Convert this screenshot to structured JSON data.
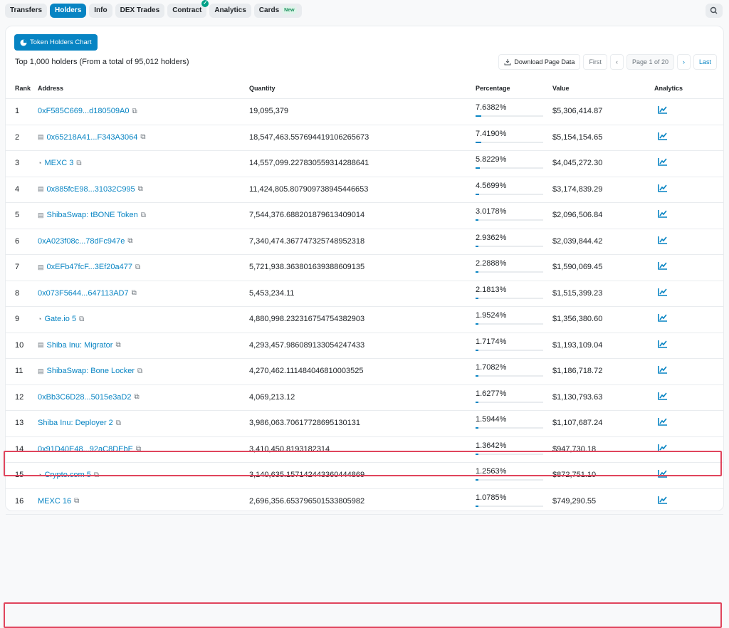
{
  "tabs": [
    {
      "label": "Transfers",
      "active": false
    },
    {
      "label": "Holders",
      "active": true
    },
    {
      "label": "Info",
      "active": false
    },
    {
      "label": "DEX Trades",
      "active": false
    },
    {
      "label": "Contract",
      "active": false,
      "verified": true
    },
    {
      "label": "Analytics",
      "active": false
    },
    {
      "label": "Cards",
      "active": false,
      "badge": "New"
    }
  ],
  "chart_button": "Token Holders Chart",
  "summary": "Top 1,000 holders (From a total of 95,012 holders)",
  "pager": {
    "download": "Download Page Data",
    "first": "First",
    "page_info": "Page 1 of 20",
    "last": "Last"
  },
  "columns": {
    "rank": "Rank",
    "address": "Address",
    "quantity": "Quantity",
    "percentage": "Percentage",
    "value": "Value",
    "analytics": "Analytics"
  },
  "holders": [
    {
      "rank": "1",
      "address": "0xF585C669...d180509A0",
      "icon": "",
      "quantity": "19,095,379",
      "percentage": "7.6382%",
      "pct": 7.6382,
      "value": "$5,306,414.87",
      "highlight": false
    },
    {
      "rank": "2",
      "address": "0x65218A41...F343A3064",
      "icon": "contract-icon",
      "quantity": "18,547,463.557694419106265673",
      "percentage": "7.4190%",
      "pct": 7.419,
      "value": "$5,154,154.65",
      "highlight": false
    },
    {
      "rank": "3",
      "address": "MEXC 3",
      "icon": "exchange-icon",
      "quantity": "14,557,099.227830559314288641",
      "percentage": "5.8229%",
      "pct": 5.8229,
      "value": "$4,045,272.30",
      "highlight": false
    },
    {
      "rank": "4",
      "address": "0x885fcE98...31032C995",
      "icon": "contract-icon",
      "quantity": "11,424,805.807909738945446653",
      "percentage": "4.5699%",
      "pct": 4.5699,
      "value": "$3,174,839.29",
      "highlight": false
    },
    {
      "rank": "5",
      "address": "ShibaSwap: tBONE Token",
      "icon": "contract-icon",
      "quantity": "7,544,376.688201879613409014",
      "percentage": "3.0178%",
      "pct": 3.0178,
      "value": "$2,096,506.84",
      "highlight": false
    },
    {
      "rank": "6",
      "address": "0xA023f08c...78dFc947e",
      "icon": "",
      "quantity": "7,340,474.367747325748952318",
      "percentage": "2.9362%",
      "pct": 2.9362,
      "value": "$2,039,844.42",
      "highlight": false
    },
    {
      "rank": "7",
      "address": "0xEFb47fcF...3Ef20a477",
      "icon": "contract-icon",
      "quantity": "5,721,938.363801639388609135",
      "percentage": "2.2888%",
      "pct": 2.2888,
      "value": "$1,590,069.45",
      "highlight": false
    },
    {
      "rank": "8",
      "address": "0x073F5644...647113AD7",
      "icon": "",
      "quantity": "5,453,234.11",
      "percentage": "2.1813%",
      "pct": 2.1813,
      "value": "$1,515,399.23",
      "highlight": true
    },
    {
      "rank": "9",
      "address": "Gate.io 5",
      "icon": "exchange-icon",
      "quantity": "4,880,998.232316754754382903",
      "percentage": "1.9524%",
      "pct": 1.9524,
      "value": "$1,356,380.60",
      "highlight": false
    },
    {
      "rank": "10",
      "address": "Shiba Inu: Migrator",
      "icon": "contract-icon",
      "quantity": "4,293,457.986089133054247433",
      "percentage": "1.7174%",
      "pct": 1.7174,
      "value": "$1,193,109.04",
      "highlight": false
    },
    {
      "rank": "11",
      "address": "ShibaSwap: Bone Locker",
      "icon": "contract-icon",
      "quantity": "4,270,462.111484046810003525",
      "percentage": "1.7082%",
      "pct": 1.7082,
      "value": "$1,186,718.72",
      "highlight": false
    },
    {
      "rank": "12",
      "address": "0xBb3C6D28...5015e3aD2",
      "icon": "",
      "quantity": "4,069,213.12",
      "percentage": "1.6277%",
      "pct": 1.6277,
      "value": "$1,130,793.63",
      "highlight": false
    },
    {
      "rank": "13",
      "address": "Shiba Inu: Deployer 2",
      "icon": "",
      "quantity": "3,986,063.70617728695130131",
      "percentage": "1.5944%",
      "pct": 1.5944,
      "value": "$1,107,687.24",
      "highlight": false
    },
    {
      "rank": "14",
      "address": "0x91D40E48...92aC8DEbE",
      "icon": "",
      "quantity": "3,410,450.8193182314",
      "percentage": "1.3642%",
      "pct": 1.3642,
      "value": "$947,730.18",
      "highlight": true
    },
    {
      "rank": "15",
      "address": "Crypto.com 5",
      "icon": "exchange-icon",
      "quantity": "3,140,635.157142443360444869",
      "percentage": "1.2563%",
      "pct": 1.2563,
      "value": "$872,751.10",
      "highlight": false
    },
    {
      "rank": "16",
      "address": "MEXC 16",
      "icon": "",
      "quantity": "2,696,356.653796501533805982",
      "percentage": "1.0785%",
      "pct": 1.0785,
      "value": "$749,290.55",
      "highlight": false
    }
  ],
  "colors": {
    "accent": "#0784c3",
    "highlight": "#e0445c"
  }
}
